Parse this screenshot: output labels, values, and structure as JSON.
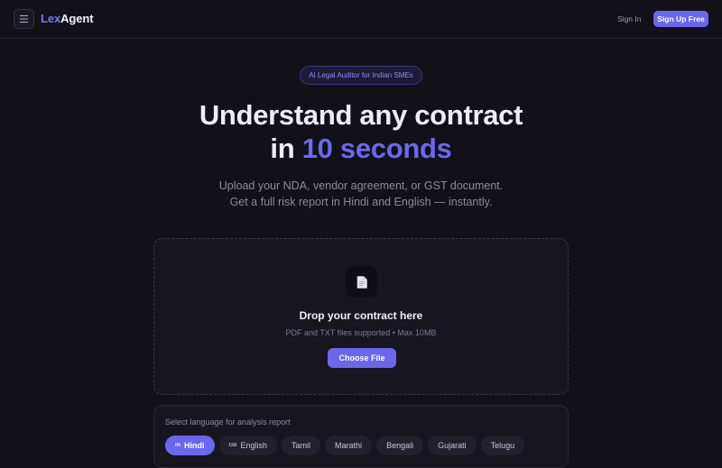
{
  "nav": {
    "logo_part1": "Lex",
    "logo_part2": "Agent",
    "sign_in": "Sign In",
    "sign_up": "Sign Up Free"
  },
  "hero": {
    "badge": "AI Legal Auditor for Indian SMEs",
    "headline_line1": "Understand any contract",
    "headline_line2_prefix": "in ",
    "headline_line2_accent": "10 seconds",
    "subtitle_line1": "Upload your NDA, vendor agreement, or GST document.",
    "subtitle_line2": "Get a full risk report in Hindi and English — instantly."
  },
  "upload": {
    "title": "Drop your contract here",
    "hint": "PDF and TXT files supported • Max 10MB",
    "button": "Choose File"
  },
  "language": {
    "label": "Select language for analysis report",
    "options": [
      {
        "code": "IN",
        "label": "Hindi",
        "selected": true
      },
      {
        "code": "GB",
        "label": "English",
        "selected": false
      },
      {
        "code": "",
        "label": "Tamil",
        "selected": false
      },
      {
        "code": "",
        "label": "Marathi",
        "selected": false
      },
      {
        "code": "",
        "label": "Bengali",
        "selected": false
      },
      {
        "code": "",
        "label": "Gujarati",
        "selected": false
      },
      {
        "code": "",
        "label": "Telugu",
        "selected": false
      }
    ]
  },
  "colors": {
    "accent": "#6a66ee",
    "background": "#121118",
    "panel": "#17161f"
  },
  "icons": {
    "menu": "hamburger-icon",
    "file": "document-icon"
  }
}
